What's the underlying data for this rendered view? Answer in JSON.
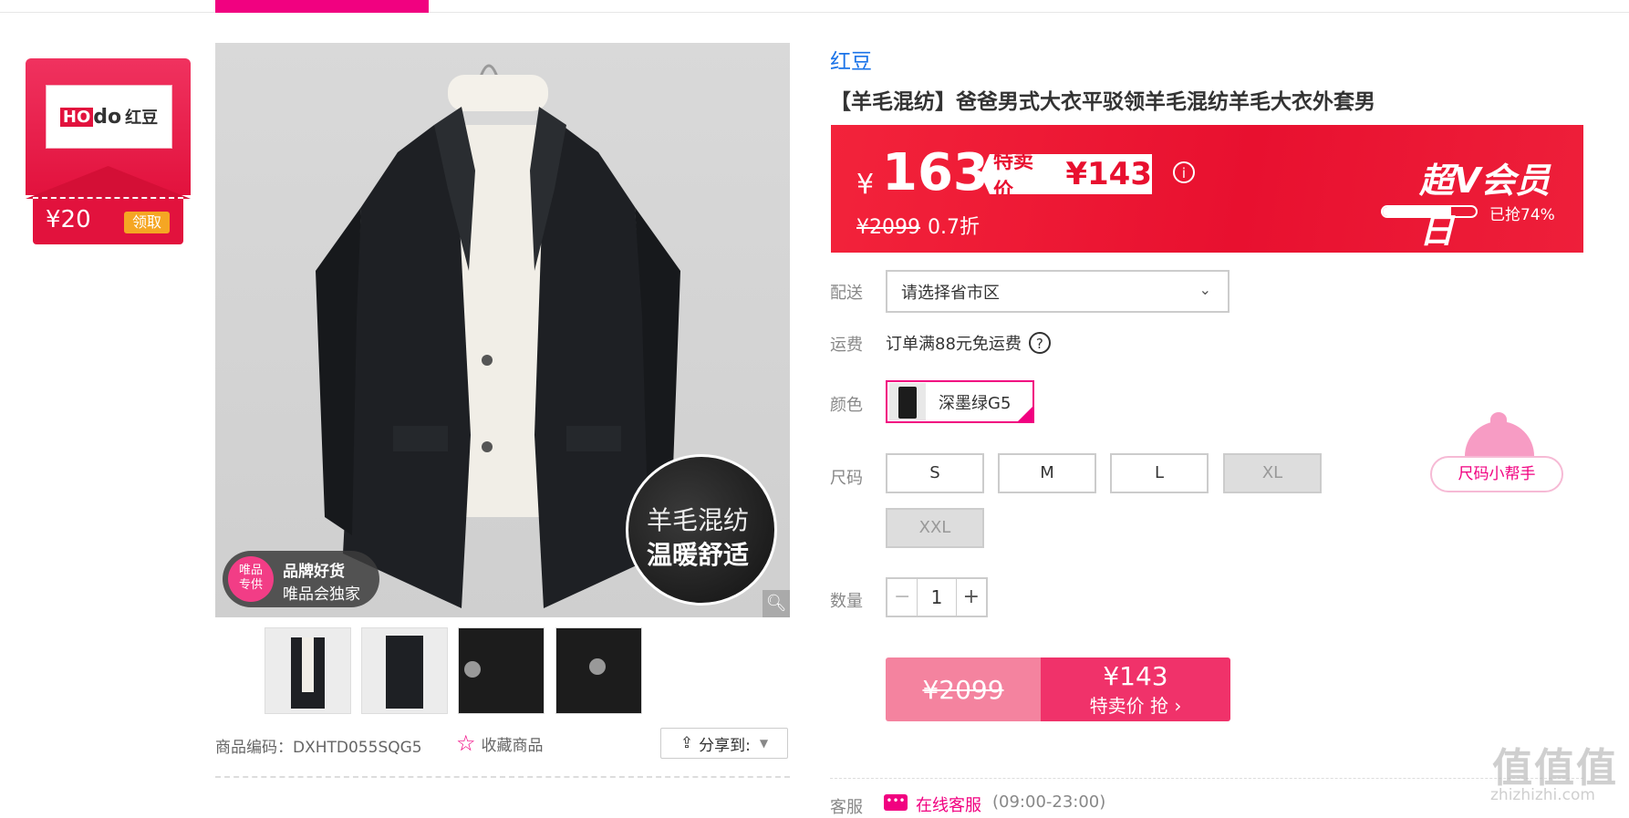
{
  "coupon": {
    "logo_prefix": "HO",
    "logo_mid": "do",
    "logo_cn": "红豆",
    "amount": "¥20",
    "claim_label": "领取"
  },
  "main_image": {
    "badge_circle": "唯品\n专供",
    "badge_title": "品牌好货",
    "badge_sub": "唯品会独家",
    "badge_right_line1": "羊毛混纺",
    "badge_right_line2": "温暖舒适"
  },
  "product": {
    "code_label": "商品编码：",
    "code": "DXHTD055SQG5",
    "favorite_label": "收藏商品",
    "share_label": "分享到:"
  },
  "info": {
    "brand": "红豆",
    "title": "【羊毛混纺】爸爸男式大衣平驳领羊毛混纺羊毛大衣外套男",
    "price": {
      "yen": "¥",
      "value": "163",
      "tag_label": "特卖价",
      "tag_price": "¥143",
      "original": "¥2099",
      "discount": "0.7折",
      "event": "超V会员日",
      "progress": 74,
      "progress_text": "已抢74%"
    },
    "delivery": {
      "label": "配送",
      "placeholder": "请选择省市区"
    },
    "freight": {
      "label": "运费",
      "text": "订单满88元免运费"
    },
    "color": {
      "label": "颜色",
      "selected": "深墨绿G5"
    },
    "size": {
      "label": "尺码",
      "options": [
        "S",
        "M",
        "L",
        "XL",
        "XXL"
      ]
    },
    "quantity": {
      "label": "数量",
      "value": "1",
      "minus": "−",
      "plus": "+"
    },
    "buy": {
      "original": "¥2099",
      "price": "¥143",
      "action": "特卖价 抢 ›"
    },
    "size_helper": "尺码小帮手",
    "service": {
      "label": "客服",
      "link": "在线客服",
      "hours": "(09:00-23:00)"
    }
  },
  "watermark": {
    "main": "值值值",
    "sub": "zhizhizhi.com"
  }
}
